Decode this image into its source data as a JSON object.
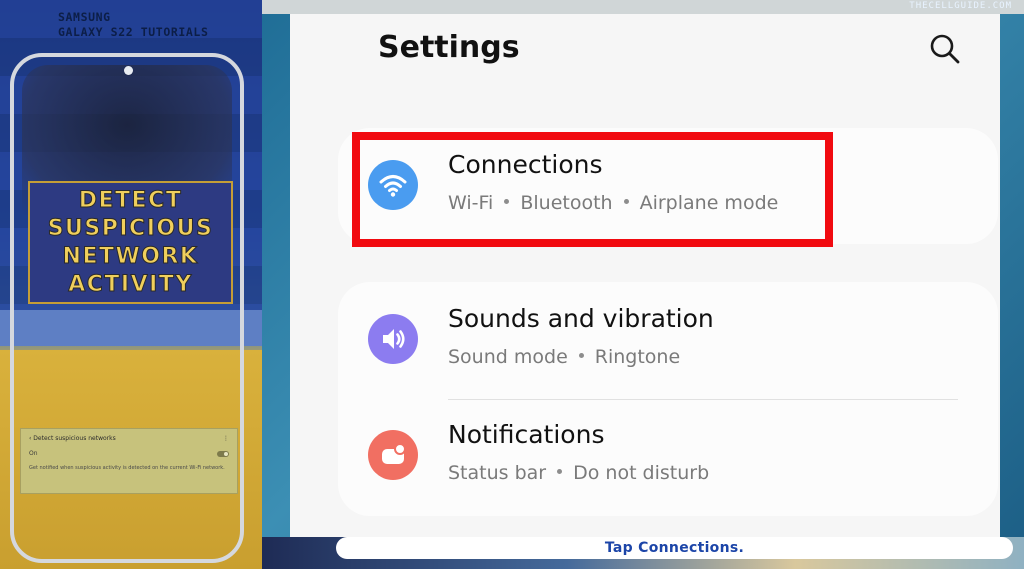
{
  "brand": {
    "line1": "SAMSUNG",
    "line2": "GALAXY S22 TUTORIALS"
  },
  "title_card": {
    "lines": [
      "DETECT",
      "SUSPICIOUS",
      "NETWORK",
      "ACTIVITY"
    ]
  },
  "mini_screen": {
    "title": "‹  Detect suspicious networks",
    "menu": "⋮",
    "toggle_label": "On",
    "description": "Get notified when suspicious activity is detected on the current Wi-Fi network."
  },
  "watermark": "THECELLGUIDE.COM",
  "settings": {
    "title": "Settings",
    "items": [
      {
        "label": "Connections",
        "subs": [
          "Wi-Fi",
          "Bluetooth",
          "Airplane mode"
        ],
        "icon": "wifi-icon",
        "color": "#4a9cf0"
      },
      {
        "label": "Sounds and vibration",
        "subs": [
          "Sound mode",
          "Ringtone"
        ],
        "icon": "volume-icon",
        "color": "#8c7cf0"
      },
      {
        "label": "Notifications",
        "subs": [
          "Status bar",
          "Do not disturb"
        ],
        "icon": "notification-icon",
        "color": "#f16f62"
      }
    ]
  },
  "highlight_color": "#f10a10",
  "caption": "Tap Connections."
}
